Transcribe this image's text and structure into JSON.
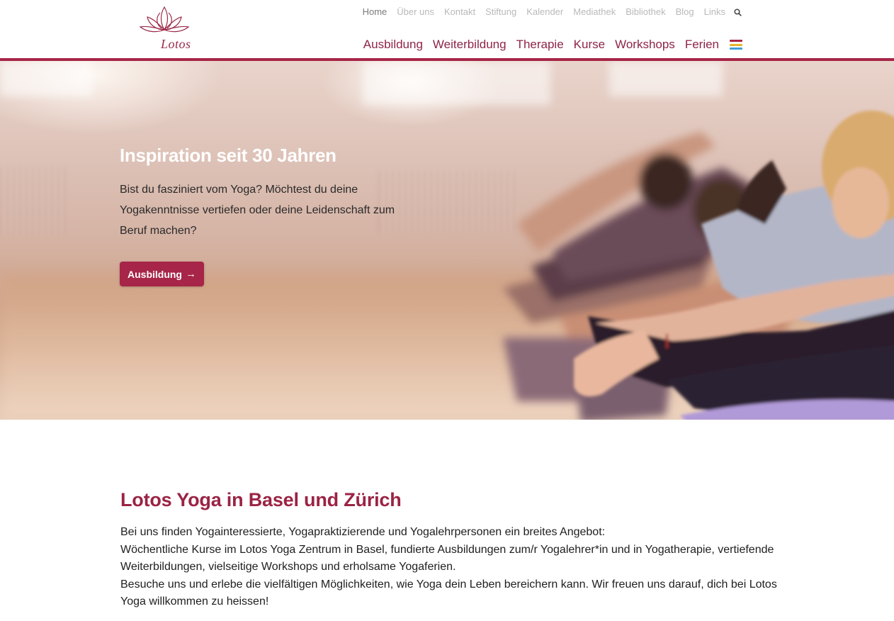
{
  "logo": {
    "text": "Lotos",
    "color": "#9b2a49"
  },
  "topnav": {
    "items": [
      "Home",
      "Über uns",
      "Kontakt",
      "Stiftung",
      "Kalender",
      "Mediathek",
      "Bibliothek",
      "Blog",
      "Links"
    ],
    "active": "Home",
    "search_icon": "search-icon"
  },
  "mainnav": {
    "items": [
      "Ausbildung",
      "Weiterbildung",
      "Therapie",
      "Kurse",
      "Workshops",
      "Ferien"
    ],
    "menu_icon": "hamburger-icon",
    "menu_colors": [
      "#a72548",
      "#e3b62a",
      "#3f9fd6"
    ]
  },
  "colors": {
    "accent": "#a72548",
    "heading": "#9b2344"
  },
  "hero": {
    "title": "Inspiration seit 30 Jahren",
    "text": "Bist du fasziniert vom Yoga? Möchtest du deine Yogakenntnisse vertiefen oder deine Leidenschaft zum Beruf machen?",
    "button_label": "Ausbildung",
    "button_icon": "arrow-right-icon",
    "arrow": "→"
  },
  "intro": {
    "title": "Lotos Yoga in Basel und Zürich",
    "lines": [
      "Bei uns finden Yogainteressierte, Yogapraktizierende und Yogalehrpersonen ein breites Angebot:",
      "Wöchentliche Kurse im Lotos Yoga Zentrum in Basel, fundierte Ausbildungen zum/r Yogalehrer*in und in Yogatherapie, vertiefende Weiterbildungen, vielseitige Workshops und erholsame Yogaferien.",
      "Besuche uns und erlebe die vielfältigen Möglichkeiten, wie Yoga dein Leben bereichern kann. Wir freuen uns darauf, dich bei Lotos Yoga willkommen zu heissen!"
    ]
  }
}
